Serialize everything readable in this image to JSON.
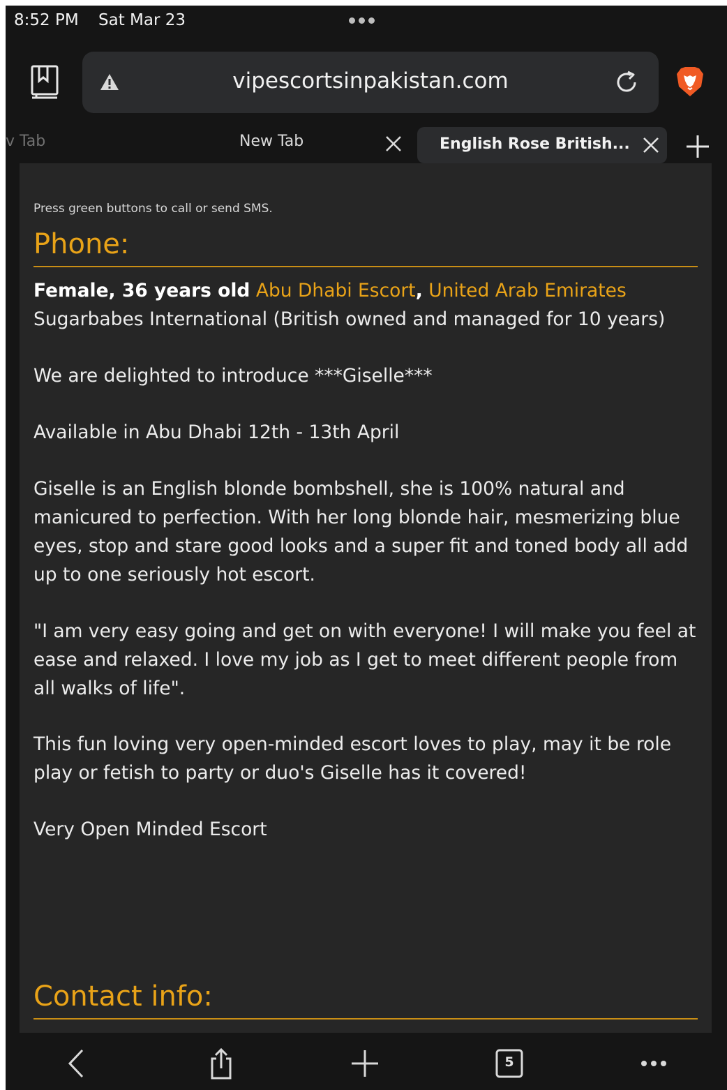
{
  "status_bar": {
    "time": "8:52 PM",
    "date": "Sat Mar 23"
  },
  "toolbar": {
    "url": "vipescortsinpakistan.com",
    "icons": {
      "bookmarks": "bookmarks-icon",
      "warning": "warning-icon",
      "reload": "reload-icon",
      "brave": "brave-lion-icon"
    }
  },
  "tabs": {
    "partial_label": "v Tab",
    "items": [
      {
        "label": "New Tab"
      },
      {
        "label": "English Rose British..."
      }
    ]
  },
  "page": {
    "hint": "Press green buttons to call or send SMS.",
    "phone_heading": "Phone:",
    "gender_age": "Female, 36 years old",
    "city_link": "Abu Dhabi Escort",
    "comma": ",",
    "country_link": "United Arab Emirates",
    "agency": "Sugarbabes International (British owned and managed for 10 years)",
    "paragraphs": [
      "We are delighted to introduce ***Giselle***",
      "Available in Abu Dhabi 12th - 13th April",
      "Giselle is an English blonde bombshell, she is 100% natural and manicured to perfection. With her long blonde hair, mesmerizing blue eyes, stop and stare good looks and a super fit and toned body all add up to one seriously hot escort.",
      "\"I am very easy going and get on with everyone! I will make you feel at ease and relaxed. I love my job as I get to meet different people from all walks of life\".",
      "This fun loving very open-minded escort loves to play, may it be role play or fetish to party or duo's Giselle has it covered!",
      "Very Open Minded Escort"
    ],
    "contact_heading": "Contact info:"
  },
  "bottom_bar": {
    "tab_count": "5"
  },
  "colors": {
    "accent": "#e9a318",
    "content_bg": "#262626",
    "chrome_bg": "#151515"
  }
}
